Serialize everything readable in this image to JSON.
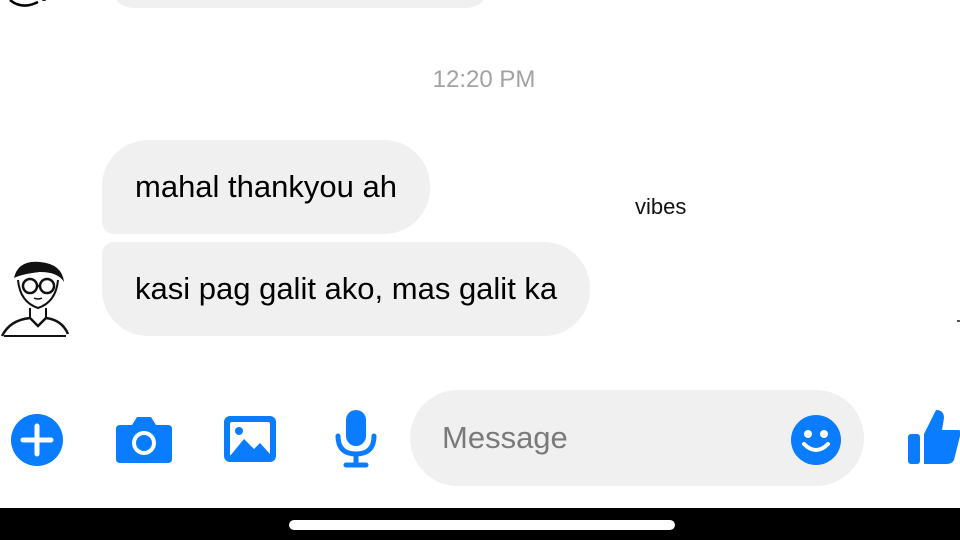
{
  "chat": {
    "timestamp": "12:20 PM",
    "messages": [
      {
        "text": "mahal thankyou ah"
      },
      {
        "text": "kasi pag galit ako, mas galit ka"
      }
    ],
    "overlay_text": "vibes"
  },
  "composer": {
    "placeholder": "Message",
    "icons": [
      "plus-icon",
      "camera-icon",
      "image-icon",
      "microphone-icon",
      "smiley-icon",
      "thumbs-up-icon"
    ]
  },
  "colors": {
    "accent": "#0a7cff",
    "bubble": "#f0f0f0",
    "timestamp": "#a2a2a2",
    "placeholder": "#7a7a7a"
  }
}
